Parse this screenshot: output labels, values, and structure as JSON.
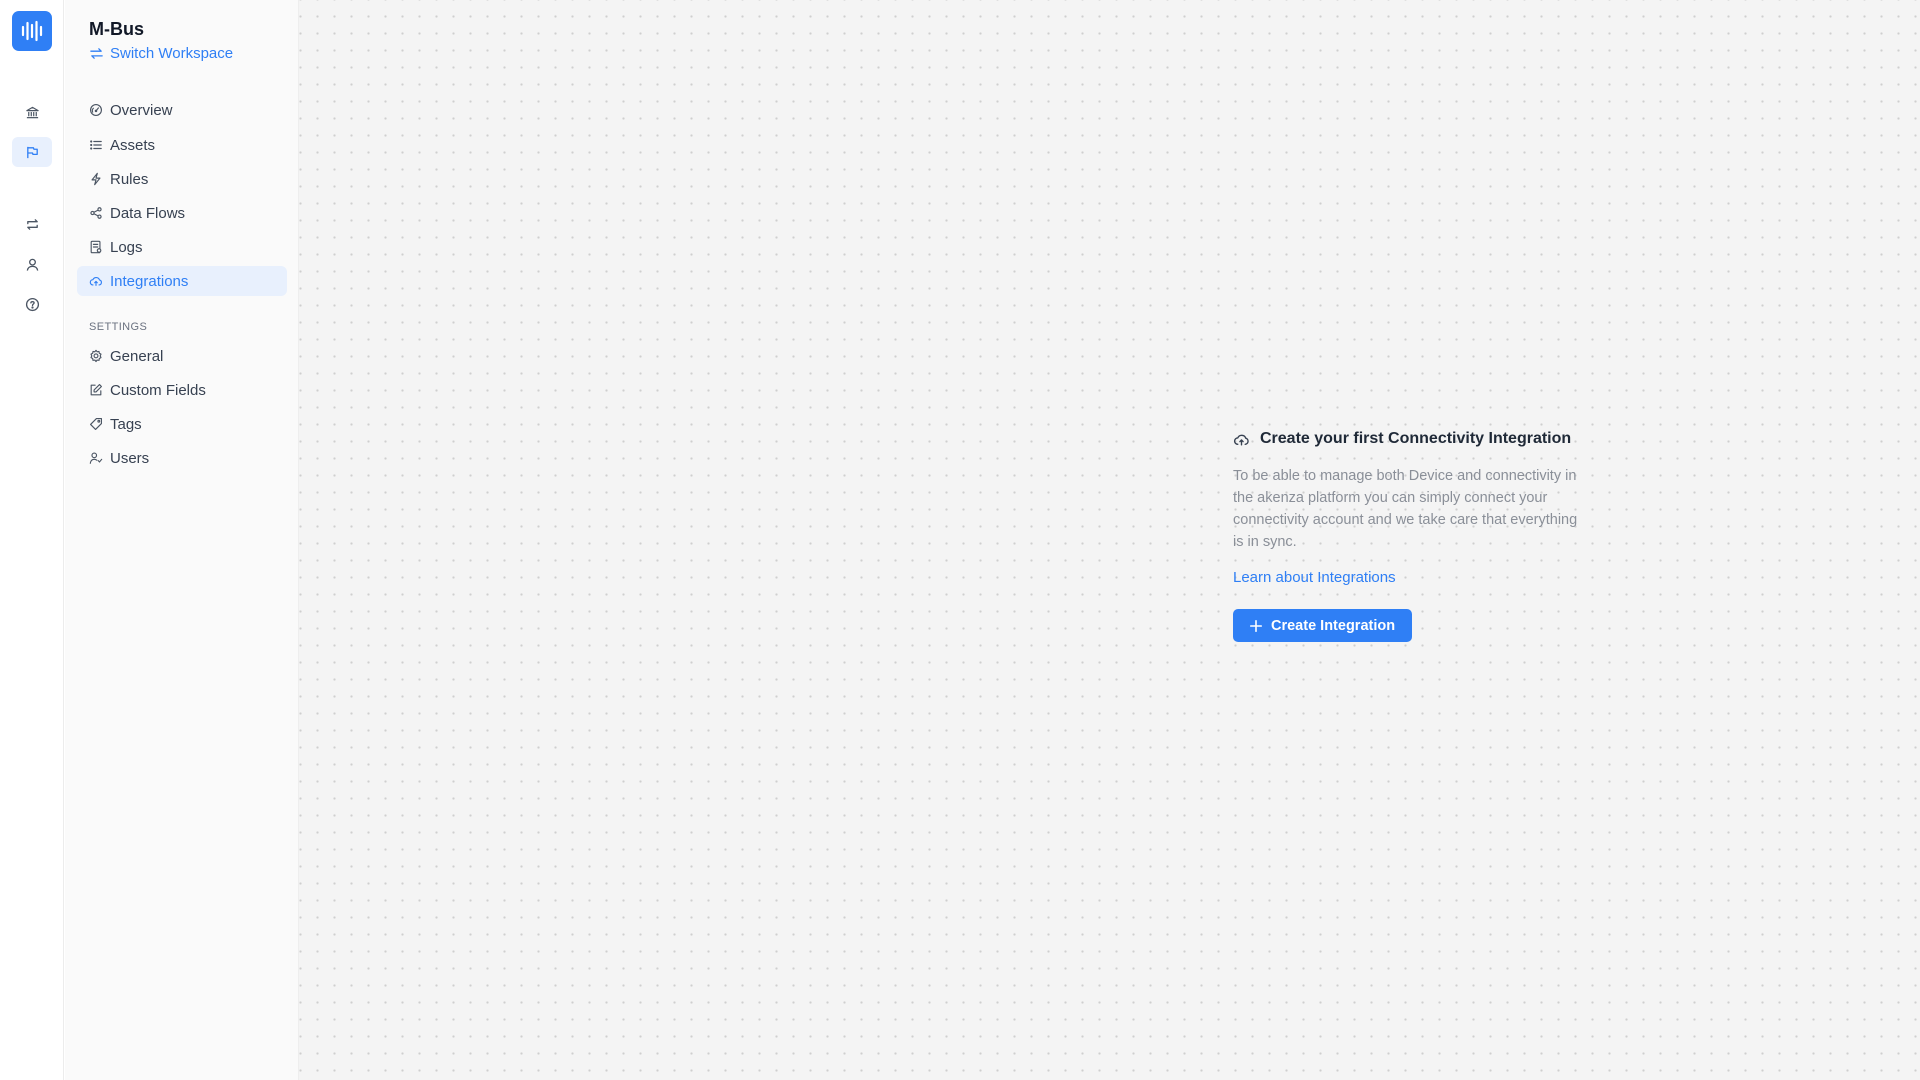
{
  "rail": {
    "icons": [
      "waveform-logo-icon",
      "bank-icon",
      "flag-icon",
      "repeat-icon",
      "user-icon",
      "help-circle-icon"
    ]
  },
  "workspace": {
    "name": "M-Bus",
    "switch_label": "Switch Workspace"
  },
  "nav": {
    "items": [
      {
        "label": "Overview",
        "icon": "gauge-icon"
      },
      {
        "label": "Assets",
        "icon": "list-icon"
      },
      {
        "label": "Rules",
        "icon": "zap-icon"
      },
      {
        "label": "Data Flows",
        "icon": "share-icon"
      },
      {
        "label": "Logs",
        "icon": "file-log-icon"
      },
      {
        "label": "Integrations",
        "icon": "cloud-sync-icon",
        "active": true
      }
    ],
    "settings_label": "SETTINGS",
    "settings_items": [
      {
        "label": "General",
        "icon": "settings-icon"
      },
      {
        "label": "Custom Fields",
        "icon": "edit-icon"
      },
      {
        "label": "Tags",
        "icon": "tag-icon"
      },
      {
        "label": "Users",
        "icon": "users-icon"
      }
    ]
  },
  "empty_state": {
    "title": "Create your first Connectivity Integration",
    "description": "To be able to manage both Device and connectivity in the akenza platform you can simply connect your connectivity account and we take care that everything is in sync.",
    "link": "Learn about Integrations",
    "button": "Create Integration"
  },
  "colors": {
    "accent": "#2f7ff5",
    "active_bg": "#e8f0fd",
    "main_bg": "#f4f4f4"
  }
}
